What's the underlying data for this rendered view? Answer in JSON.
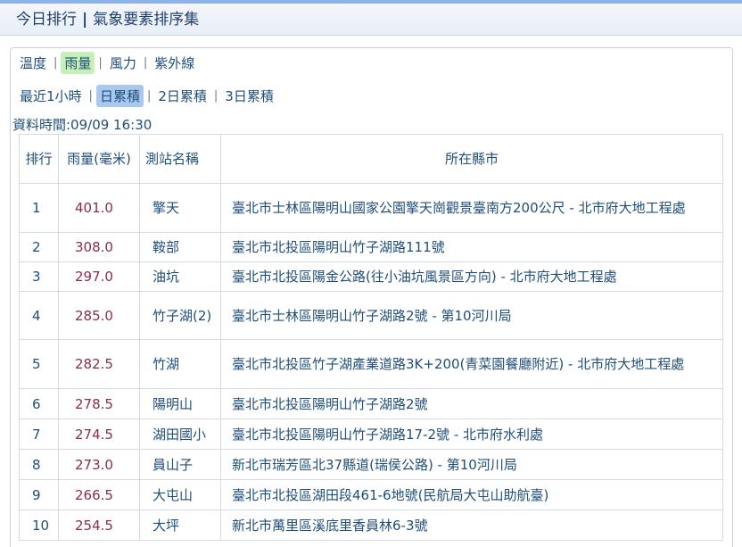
{
  "header": {
    "title_left": "今日排行",
    "separator": "|",
    "title_right": "氣象要素排序集"
  },
  "element_tabs": [
    {
      "label": "溫度",
      "active": false
    },
    {
      "label": "雨量",
      "active": true
    },
    {
      "label": "風力",
      "active": false
    },
    {
      "label": "紫外線",
      "active": false
    }
  ],
  "period_tabs": [
    {
      "label": "最近1小時",
      "active": false
    },
    {
      "label": "日累積",
      "active": true
    },
    {
      "label": "2日累積",
      "active": false
    },
    {
      "label": "3日累積",
      "active": false
    }
  ],
  "data_time": "資料時間:09/09 16:30",
  "table": {
    "headers": {
      "rank": "排行",
      "rainfall": "雨量(毫米)",
      "station": "測站名稱",
      "location": "所在縣市"
    },
    "rows": [
      {
        "rank": "1",
        "rainfall": "401.0",
        "station": "擎天",
        "location": "臺北市士林區陽明山國家公園擎天崗觀景臺南方200公尺 - 北市府大地工程處"
      },
      {
        "rank": "2",
        "rainfall": "308.0",
        "station": "鞍部",
        "location": "臺北市北投區陽明山竹子湖路111號"
      },
      {
        "rank": "3",
        "rainfall": "297.0",
        "station": "油坑",
        "location": "臺北市北投區陽金公路(往小油坑風景區方向) - 北市府大地工程處"
      },
      {
        "rank": "4",
        "rainfall": "285.0",
        "station": "竹子湖(2)",
        "location": "臺北市士林區陽明山竹子湖路2號 - 第10河川局"
      },
      {
        "rank": "5",
        "rainfall": "282.5",
        "station": "竹湖",
        "location": "臺北市北投區竹子湖產業道路3K+200(青菜園餐廳附近) - 北市府大地工程處"
      },
      {
        "rank": "6",
        "rainfall": "278.5",
        "station": "陽明山",
        "location": "臺北市北投區陽明山竹子湖路2號"
      },
      {
        "rank": "7",
        "rainfall": "274.5",
        "station": "湖田國小",
        "location": "臺北市北投區陽明山竹子湖路17-2號 - 北市府水利處"
      },
      {
        "rank": "8",
        "rainfall": "273.0",
        "station": "員山子",
        "location": "新北市瑞芳區北37縣道(瑞侯公路) - 第10河川局"
      },
      {
        "rank": "9",
        "rainfall": "266.5",
        "station": "大屯山",
        "location": "臺北市北投區湖田段461-6地號(民航局大屯山助航臺)"
      },
      {
        "rank": "10",
        "rainfall": "254.5",
        "station": "大坪",
        "location": "新北市萬里區溪底里香員林6-3號"
      }
    ]
  }
}
